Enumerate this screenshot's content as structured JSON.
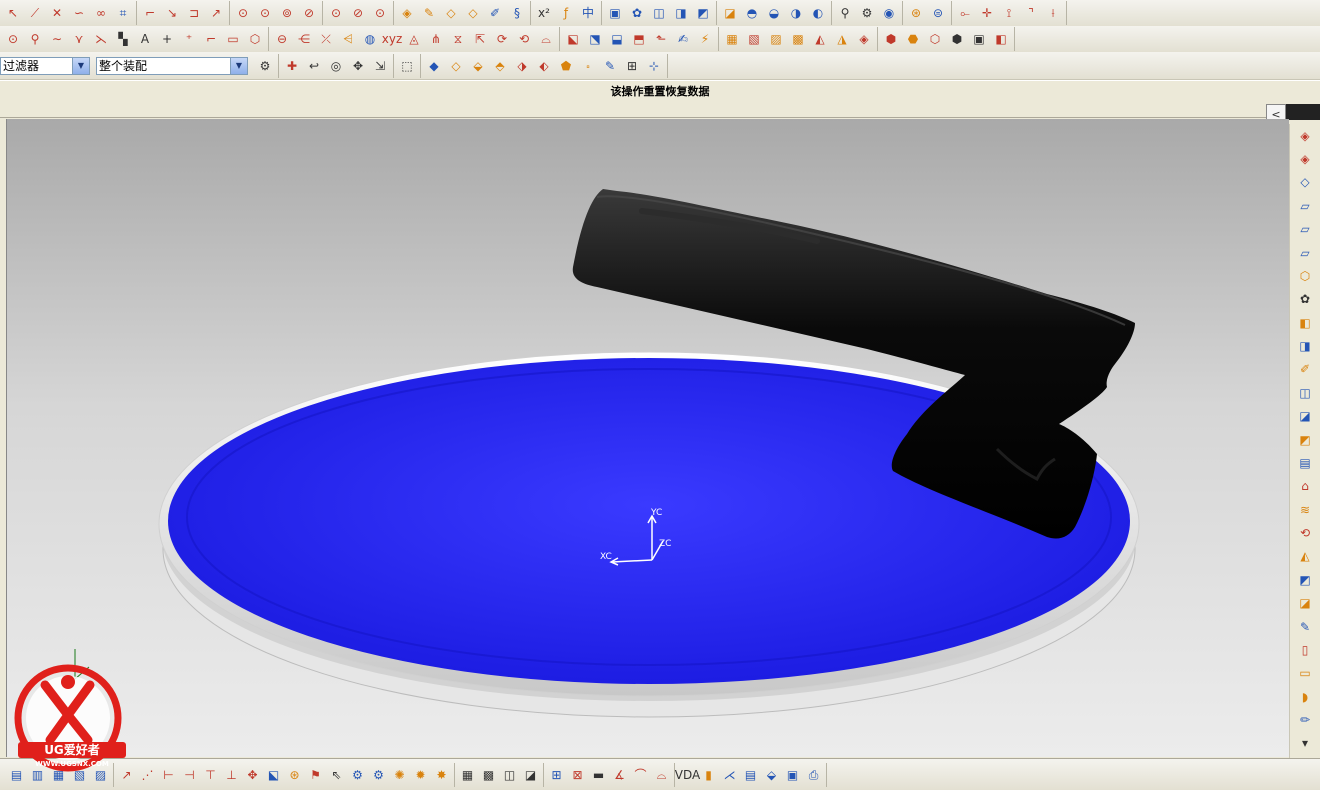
{
  "toolbar1": [
    {
      "name": "arc-icon",
      "g": "↖",
      "c": "red"
    },
    {
      "name": "line-icon",
      "g": "⟋",
      "c": "red"
    },
    {
      "name": "cross-icon",
      "g": "✕",
      "c": "red"
    },
    {
      "name": "curve-icon",
      "g": "∽",
      "c": "red"
    },
    {
      "name": "spline-icon",
      "g": "∞",
      "c": "red"
    },
    {
      "name": "grid-icon",
      "g": "⌗",
      "c": "blue"
    },
    {
      "name": "fillet-icon",
      "g": "⌐",
      "c": "red"
    },
    {
      "name": "chamfer-icon",
      "g": "↘",
      "c": "red"
    },
    {
      "name": "corner-icon",
      "g": "⊐",
      "c": "red"
    },
    {
      "name": "extend-icon",
      "g": "↗",
      "c": "red"
    },
    {
      "name": "circle-icon",
      "g": "⊙",
      "c": "red"
    },
    {
      "name": "circle2-icon",
      "g": "⊙",
      "c": "red"
    },
    {
      "name": "circle3-icon",
      "g": "⊚",
      "c": "red"
    },
    {
      "name": "circle4-icon",
      "g": "⊘",
      "c": "red"
    },
    {
      "name": "point-icon",
      "g": "⊙",
      "c": "red"
    },
    {
      "name": "point2-icon",
      "g": "⊘",
      "c": "red"
    },
    {
      "name": "point3-icon",
      "g": "⊙",
      "c": "red"
    },
    {
      "name": "feature-icon",
      "g": "◈",
      "c": "orange"
    },
    {
      "name": "sketch-icon",
      "g": "✎",
      "c": "orange"
    },
    {
      "name": "plane-icon",
      "g": "◇",
      "c": "orange"
    },
    {
      "name": "plane2-icon",
      "g": "◇",
      "c": "orange"
    },
    {
      "name": "edit-icon",
      "g": "✐",
      "c": "blue"
    },
    {
      "name": "surf-icon",
      "g": "§",
      "c": "blue"
    },
    {
      "name": "exp-icon",
      "g": "x²",
      "c": "dark"
    },
    {
      "name": "law-icon",
      "g": "ƒ",
      "c": "orange"
    },
    {
      "name": "split-icon",
      "g": "中",
      "c": "blue"
    },
    {
      "name": "box-icon",
      "g": "▣",
      "c": "blue"
    },
    {
      "name": "pattern-icon",
      "g": "✿",
      "c": "blue"
    },
    {
      "name": "shell-icon",
      "g": "◫",
      "c": "blue"
    },
    {
      "name": "face-icon",
      "g": "◨",
      "c": "blue"
    },
    {
      "name": "sew-icon",
      "g": "◩",
      "c": "blue"
    },
    {
      "name": "patch-icon",
      "g": "◪",
      "c": "orange"
    },
    {
      "name": "blend-icon",
      "g": "◓",
      "c": "blue"
    },
    {
      "name": "offset-icon",
      "g": "◒",
      "c": "blue"
    },
    {
      "name": "thicken-icon",
      "g": "◑",
      "c": "blue"
    },
    {
      "name": "trim-icon",
      "g": "◐",
      "c": "blue"
    },
    {
      "name": "draft-icon",
      "g": "⚲",
      "c": "dark"
    },
    {
      "name": "emboss-icon",
      "g": "⚙",
      "c": "dark"
    },
    {
      "name": "wrap-icon",
      "g": "◉",
      "c": "blue"
    },
    {
      "name": "analysis-icon",
      "g": "⊛",
      "c": "orange"
    },
    {
      "name": "section-icon",
      "g": "⊜",
      "c": "blue"
    },
    {
      "name": "isocline-icon",
      "g": "⟜",
      "c": "red"
    },
    {
      "name": "node-icon",
      "g": "✛",
      "c": "red"
    },
    {
      "name": "fork-icon",
      "g": "⟟",
      "c": "red"
    },
    {
      "name": "bend-icon",
      "g": "⌝",
      "c": "red"
    },
    {
      "name": "slice-icon",
      "g": "⟊",
      "c": "red"
    }
  ],
  "toolbar2": [
    {
      "name": "snap-icon",
      "g": "⊙",
      "c": "red"
    },
    {
      "name": "probe-icon",
      "g": "⚲",
      "c": "red"
    },
    {
      "name": "wave-icon",
      "g": "∼",
      "c": "red"
    },
    {
      "name": "bird-icon",
      "g": "⋎",
      "c": "red"
    },
    {
      "name": "angle-icon",
      "g": "⋋",
      "c": "red"
    },
    {
      "name": "tile-icon",
      "g": "▚",
      "c": "dark"
    },
    {
      "name": "text-icon",
      "g": "A",
      "c": "dark"
    },
    {
      "name": "plus-icon",
      "g": "+",
      "c": "dark"
    },
    {
      "name": "plus2-icon",
      "g": "⁺",
      "c": "red"
    },
    {
      "name": "hook-icon",
      "g": "⌐",
      "c": "red"
    },
    {
      "name": "rect-icon",
      "g": "▭",
      "c": "red"
    },
    {
      "name": "poly-icon",
      "g": "⬡",
      "c": "red"
    },
    {
      "name": "ellipse-icon",
      "g": "⊖",
      "c": "red"
    },
    {
      "name": "bracket-icon",
      "g": "⋲",
      "c": "red"
    },
    {
      "name": "intersect-icon",
      "g": "⤫",
      "c": "red"
    },
    {
      "name": "loft-icon",
      "g": "⩤",
      "c": "orange"
    },
    {
      "name": "sphere-icon",
      "g": "◍",
      "c": "blue"
    },
    {
      "name": "xyz-icon",
      "g": "xyz",
      "c": "red"
    },
    {
      "name": "shape-icon",
      "g": "◬",
      "c": "red"
    },
    {
      "name": "join-icon",
      "g": "⋔",
      "c": "red"
    },
    {
      "name": "mirror-icon",
      "g": "⧖",
      "c": "red"
    },
    {
      "name": "proj-icon",
      "g": "⇱",
      "c": "red"
    },
    {
      "name": "wrap2-icon",
      "g": "⟳",
      "c": "red"
    },
    {
      "name": "offset2-icon",
      "g": "⟲",
      "c": "red"
    },
    {
      "name": "bridge-icon",
      "g": "⌓",
      "c": "red"
    },
    {
      "name": "combo-icon",
      "g": "⬕",
      "c": "red"
    },
    {
      "name": "curve2-icon",
      "g": "⬔",
      "c": "blue"
    },
    {
      "name": "curve3-icon",
      "g": "⬓",
      "c": "blue"
    },
    {
      "name": "curve4-icon",
      "g": "⬒",
      "c": "red"
    },
    {
      "name": "curve5-icon",
      "g": "⬑",
      "c": "red"
    },
    {
      "name": "brush-icon",
      "g": "✍",
      "c": "blue"
    },
    {
      "name": "wand-icon",
      "g": "⚡",
      "c": "orange"
    },
    {
      "name": "solid-icon",
      "g": "▦",
      "c": "orange"
    },
    {
      "name": "solid2-icon",
      "g": "▧",
      "c": "red"
    },
    {
      "name": "solid3-icon",
      "g": "▨",
      "c": "orange"
    },
    {
      "name": "solid4-icon",
      "g": "▩",
      "c": "orange"
    },
    {
      "name": "solid5-icon",
      "g": "◭",
      "c": "red"
    },
    {
      "name": "solid6-icon",
      "g": "◮",
      "c": "orange"
    },
    {
      "name": "solid7-icon",
      "g": "◈",
      "c": "red"
    },
    {
      "name": "asm-icon",
      "g": "⬢",
      "c": "red"
    },
    {
      "name": "asm2-icon",
      "g": "⬣",
      "c": "orange"
    },
    {
      "name": "asm3-icon",
      "g": "⬡",
      "c": "red"
    },
    {
      "name": "hex-icon",
      "g": "⬢",
      "c": "dark"
    },
    {
      "name": "clip-icon",
      "g": "▣",
      "c": "dark"
    },
    {
      "name": "eraser-icon",
      "g": "◧",
      "c": "red"
    }
  ],
  "toolbar3": {
    "filter_value": "过滤器",
    "scope_value": "整个装配",
    "icons": [
      {
        "name": "selection-tools-icon",
        "g": "⚙",
        "c": "dark"
      },
      {
        "name": "snap-point-icon",
        "g": "✚",
        "c": "red"
      },
      {
        "name": "undo-icon",
        "g": "↩",
        "c": "dark"
      },
      {
        "name": "view-icon",
        "g": "◎",
        "c": "dark"
      },
      {
        "name": "pan-icon",
        "g": "✥",
        "c": "dark"
      },
      {
        "name": "zoom-icon",
        "g": "⇲",
        "c": "dark"
      },
      {
        "name": "box-select-icon",
        "g": "⬚",
        "c": "dark"
      },
      {
        "name": "cube-view-icon",
        "g": "◆",
        "c": "blue"
      },
      {
        "name": "iso-view-icon",
        "g": "◇",
        "c": "orange"
      },
      {
        "name": "top-view-icon",
        "g": "⬙",
        "c": "orange"
      },
      {
        "name": "front-view-icon",
        "g": "⬘",
        "c": "orange"
      },
      {
        "name": "right-view-icon",
        "g": "⬗",
        "c": "red"
      },
      {
        "name": "left-view-icon",
        "g": "⬖",
        "c": "red"
      },
      {
        "name": "bottom-view-icon",
        "g": "⬟",
        "c": "orange"
      },
      {
        "name": "back-view-icon",
        "g": "⬞",
        "c": "orange"
      },
      {
        "name": "render-icon",
        "g": "✎",
        "c": "blue"
      },
      {
        "name": "fit-icon",
        "g": "⊞",
        "c": "dark"
      },
      {
        "name": "orient-icon",
        "g": "⊹",
        "c": "blue"
      }
    ]
  },
  "status_text": "该操作重置恢复数据",
  "collapse_glyph": "<",
  "right_toolbar": [
    {
      "name": "spline-panel-icon",
      "g": "◈",
      "c": "red"
    },
    {
      "name": "pole-icon",
      "g": "◈",
      "c": "red"
    },
    {
      "name": "through-icon",
      "g": "◇",
      "c": "blue"
    },
    {
      "name": "ruled-icon",
      "g": "▱",
      "c": "blue"
    },
    {
      "name": "grid-surf-icon",
      "g": "▱",
      "c": "blue"
    },
    {
      "name": "mesh-icon",
      "g": "▱",
      "c": "blue"
    },
    {
      "name": "swept-icon",
      "g": "⬡",
      "c": "orange"
    },
    {
      "name": "tube-icon",
      "g": "✿",
      "c": "dark"
    },
    {
      "name": "bound-icon",
      "g": "◧",
      "c": "orange"
    },
    {
      "name": "n-side-icon",
      "g": "◨",
      "c": "blue"
    },
    {
      "name": "pen-icon",
      "g": "✐",
      "c": "orange"
    },
    {
      "name": "offset-surf-icon",
      "g": "◫",
      "c": "blue"
    },
    {
      "name": "ext-surf-icon",
      "g": "◪",
      "c": "blue"
    },
    {
      "name": "layer-icon",
      "g": "◩",
      "c": "orange"
    },
    {
      "name": "stack-icon",
      "g": "▤",
      "c": "blue"
    },
    {
      "name": "roof-icon",
      "g": "⌂",
      "c": "red"
    },
    {
      "name": "wave-surf-icon",
      "g": "≋",
      "c": "orange"
    },
    {
      "name": "rotate-surf-icon",
      "g": "⟲",
      "c": "red"
    },
    {
      "name": "layers-icon",
      "g": "◭",
      "c": "orange"
    },
    {
      "name": "tilt-icon",
      "g": "◩",
      "c": "blue"
    },
    {
      "name": "fold-icon",
      "g": "◪",
      "c": "orange"
    },
    {
      "name": "edit-surf-icon",
      "g": "✎",
      "c": "blue"
    },
    {
      "name": "cylinder-icon",
      "g": "▯",
      "c": "red"
    },
    {
      "name": "pipe-icon",
      "g": "▭",
      "c": "orange"
    },
    {
      "name": "drop-icon",
      "g": "◗",
      "c": "orange"
    },
    {
      "name": "pencil-surf-icon",
      "g": "✏",
      "c": "blue"
    },
    {
      "name": "scroll-down-icon",
      "g": "▾",
      "c": "dark"
    }
  ],
  "bottom_toolbar": [
    {
      "name": "sheet-icon",
      "g": "▤",
      "c": "blue"
    },
    {
      "name": "sheet2-icon",
      "g": "▥",
      "c": "blue"
    },
    {
      "name": "sheet3-icon",
      "g": "▦",
      "c": "blue"
    },
    {
      "name": "sheet4-icon",
      "g": "▧",
      "c": "blue"
    },
    {
      "name": "sheet5-icon",
      "g": "▨",
      "c": "blue"
    },
    {
      "name": "sel-curve-icon",
      "g": "↗",
      "c": "red"
    },
    {
      "name": "sel-end-icon",
      "g": "⋰",
      "c": "red"
    },
    {
      "name": "sel-mid-icon",
      "g": "⊢",
      "c": "red"
    },
    {
      "name": "sel-ctr-icon",
      "g": "⊣",
      "c": "red"
    },
    {
      "name": "sel-quad-icon",
      "g": "⊤",
      "c": "red"
    },
    {
      "name": "sel-int-icon",
      "g": "⊥",
      "c": "red"
    },
    {
      "name": "sel-pt-icon",
      "g": "✥",
      "c": "red"
    },
    {
      "name": "sel-face-icon",
      "g": "⬕",
      "c": "blue"
    },
    {
      "name": "sel-bound-icon",
      "g": "⊛",
      "c": "orange"
    },
    {
      "name": "sel-flag-icon",
      "g": "⚑",
      "c": "red"
    },
    {
      "name": "cursor-icon",
      "g": "⇖",
      "c": "dark"
    },
    {
      "name": "gear-sel-icon",
      "g": "⚙",
      "c": "blue"
    },
    {
      "name": "gear2-sel-icon",
      "g": "⚙",
      "c": "blue"
    },
    {
      "name": "gear3-sel-icon",
      "g": "✺",
      "c": "orange"
    },
    {
      "name": "gear4-sel-icon",
      "g": "✹",
      "c": "orange"
    },
    {
      "name": "gear5-sel-icon",
      "g": "✸",
      "c": "orange"
    },
    {
      "name": "grid-display-icon",
      "g": "▦",
      "c": "dark"
    },
    {
      "name": "grid2-display-icon",
      "g": "▩",
      "c": "dark"
    },
    {
      "name": "wire-icon",
      "g": "◫",
      "c": "dark"
    },
    {
      "name": "wire2-icon",
      "g": "◪",
      "c": "dark"
    },
    {
      "name": "measure-icon",
      "g": "⊞",
      "c": "blue"
    },
    {
      "name": "measure2-icon",
      "g": "⊠",
      "c": "red"
    },
    {
      "name": "ruler-icon",
      "g": "▬",
      "c": "dark"
    },
    {
      "name": "angle-measure-icon",
      "g": "∡",
      "c": "red"
    },
    {
      "name": "arc-measure-icon",
      "g": "⌒",
      "c": "red"
    },
    {
      "name": "bend-measure-icon",
      "g": "⌓",
      "c": "red"
    },
    {
      "name": "vda-icon",
      "g": "VDA",
      "c": "dark"
    },
    {
      "name": "color-map-icon",
      "g": "▮",
      "c": "orange"
    },
    {
      "name": "curv-icon",
      "g": "⋌",
      "c": "blue"
    },
    {
      "name": "chart-icon",
      "g": "▤",
      "c": "blue"
    },
    {
      "name": "save-bottom-icon",
      "g": "⬙",
      "c": "blue"
    },
    {
      "name": "info-bottom-icon",
      "g": "▣",
      "c": "blue"
    },
    {
      "name": "print-icon",
      "g": "⎙",
      "c": "blue"
    }
  ],
  "viewport": {
    "csys_labels": {
      "x": "XC",
      "y": "YC",
      "z": "ZC"
    },
    "plate_color": "#2222ff",
    "rim_color": "#f4f4f4",
    "handle_color": "#0c0c0c"
  },
  "logo": {
    "brand": "UG爱好者",
    "url": "WWW.UGSNX.COM",
    "accent": "#e0201b"
  }
}
